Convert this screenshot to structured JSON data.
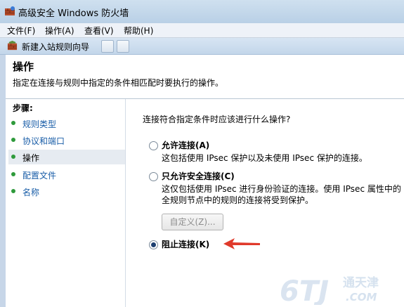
{
  "window": {
    "title": "高级安全 Windows 防火墙"
  },
  "menubar": {
    "items": [
      "文件(F)",
      "操作(A)",
      "查看(V)",
      "帮助(H)"
    ]
  },
  "wizard": {
    "title": "新建入站规则向导"
  },
  "header": {
    "title": "操作",
    "description": "指定在连接与规则中指定的条件相匹配时要执行的操作。"
  },
  "steps": {
    "title": "步骤:",
    "items": [
      {
        "label": "规则类型",
        "active": false
      },
      {
        "label": "协议和端口",
        "active": false
      },
      {
        "label": "操作",
        "active": true
      },
      {
        "label": "配置文件",
        "active": false
      },
      {
        "label": "名称",
        "active": false
      }
    ]
  },
  "content": {
    "question": "连接符合指定条件时应该进行什么操作?",
    "options": [
      {
        "label": "允许连接(A)",
        "desc": "这包括使用 IPsec 保护以及未使用 IPsec 保护的连接。",
        "checked": false
      },
      {
        "label": "只允许安全连接(C)",
        "desc1": "这仅包括使用 IPsec 进行身份验证的连接。使用 IPsec 属性中的",
        "desc2": "全规则节点中的规则的连接将受到保护。",
        "checked": false
      },
      {
        "label": "阻止连接(K)",
        "checked": true
      }
    ],
    "custom_button": "自定义(Z)..."
  },
  "watermark": {
    "text": "6TJ",
    "sub": "通天津",
    "domain": ".COM"
  },
  "colors": {
    "accent": "#1a5ea8",
    "arrow": "#e03a2b",
    "step_dot": "#2e9a3b"
  },
  "icons": [
    "firewall-icon",
    "wizard-firewall-icon",
    "arrow-annotation-icon"
  ]
}
